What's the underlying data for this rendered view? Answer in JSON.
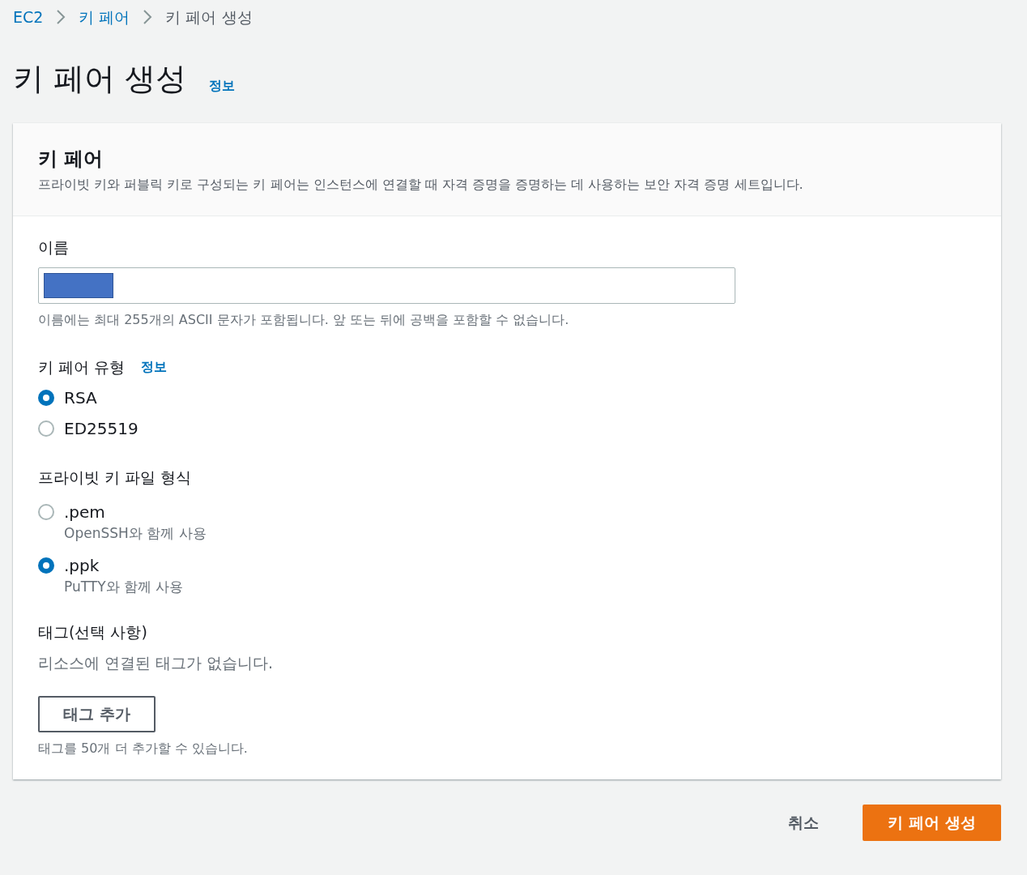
{
  "breadcrumb": [
    {
      "label": "EC2",
      "link": true
    },
    {
      "label": "키 페어",
      "link": true
    },
    {
      "label": "키 페어 생성",
      "link": false
    }
  ],
  "page": {
    "title": "키 페어 생성",
    "info": "정보"
  },
  "card": {
    "title": "키 페어",
    "description": "프라이빗 키와 퍼블릭 키로 구성되는 키 페어는 인스턴스에 연결할 때 자격 증명을 증명하는 데 사용하는 보안 자격 증명 세트입니다."
  },
  "name_field": {
    "label": "이름",
    "redacted": true,
    "hint": "이름에는 최대 255개의 ASCII 문자가 포함됩니다. 앞 또는 뒤에 공백을 포함할 수 없습니다."
  },
  "key_type": {
    "label": "키 페어 유형",
    "info": "정보",
    "options": [
      {
        "label": "RSA",
        "selected": true
      },
      {
        "label": "ED25519",
        "selected": false
      }
    ]
  },
  "file_format": {
    "label": "프라이빗 키 파일 형식",
    "options": [
      {
        "label": ".pem",
        "description": "OpenSSH와 함께 사용",
        "selected": false
      },
      {
        "label": ".ppk",
        "description": "PuTTY와 함께 사용",
        "selected": true
      }
    ]
  },
  "tags": {
    "label": "태그(선택 사항)",
    "empty": "리소스에 연결된 태그가 없습니다.",
    "add_button": "태그 추가",
    "hint": "태그를 50개 더 추가할 수 있습니다."
  },
  "footer": {
    "cancel": "취소",
    "submit": "키 페어 생성"
  }
}
